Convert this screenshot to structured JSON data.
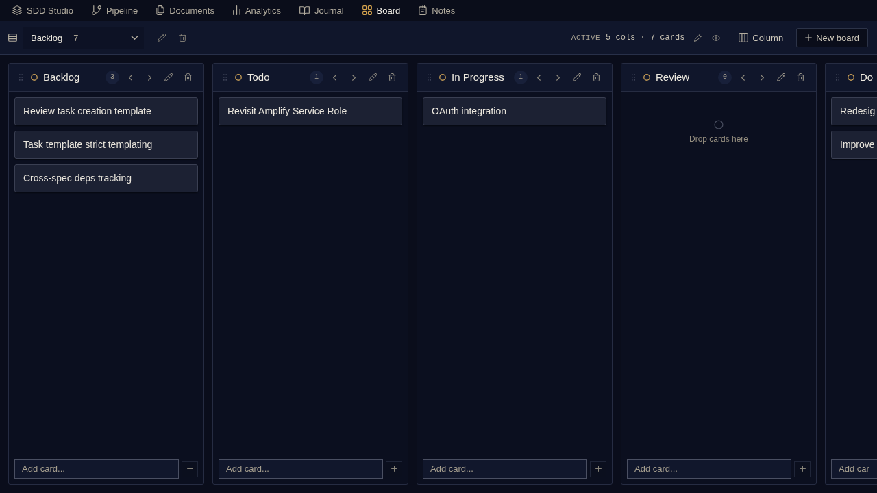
{
  "nav": [
    {
      "label": "SDD Studio",
      "selected": false
    },
    {
      "label": "Pipeline",
      "selected": false
    },
    {
      "label": "Documents",
      "selected": false
    },
    {
      "label": "Analytics",
      "selected": false
    },
    {
      "label": "Journal",
      "selected": false
    },
    {
      "label": "Board",
      "selected": true
    },
    {
      "label": "Notes",
      "selected": false
    }
  ],
  "toolbar": {
    "board_select": {
      "value": "Backlog",
      "count": "7"
    },
    "status_label": "ACTIVE",
    "summary": "5 cols · 7 cards",
    "view_button": "Column",
    "new_board_button": "New board"
  },
  "columns": [
    {
      "title": "Backlog",
      "count": "3",
      "cards": [
        "Review task creation template",
        "Task template strict templating",
        "Cross-spec deps tracking"
      ],
      "add_placeholder": "Add card..."
    },
    {
      "title": "Todo",
      "count": "1",
      "cards": [
        "Revisit Amplify Service Role"
      ],
      "add_placeholder": "Add card..."
    },
    {
      "title": "In Progress",
      "count": "1",
      "cards": [
        "OAuth integration"
      ],
      "add_placeholder": "Add card..."
    },
    {
      "title": "Review",
      "count": "0",
      "empty_text": "Drop cards here",
      "add_placeholder": "Add card..."
    },
    {
      "title": "Do",
      "cards": [
        "Redesig",
        "Improve"
      ],
      "add_placeholder": "Add car"
    }
  ]
}
